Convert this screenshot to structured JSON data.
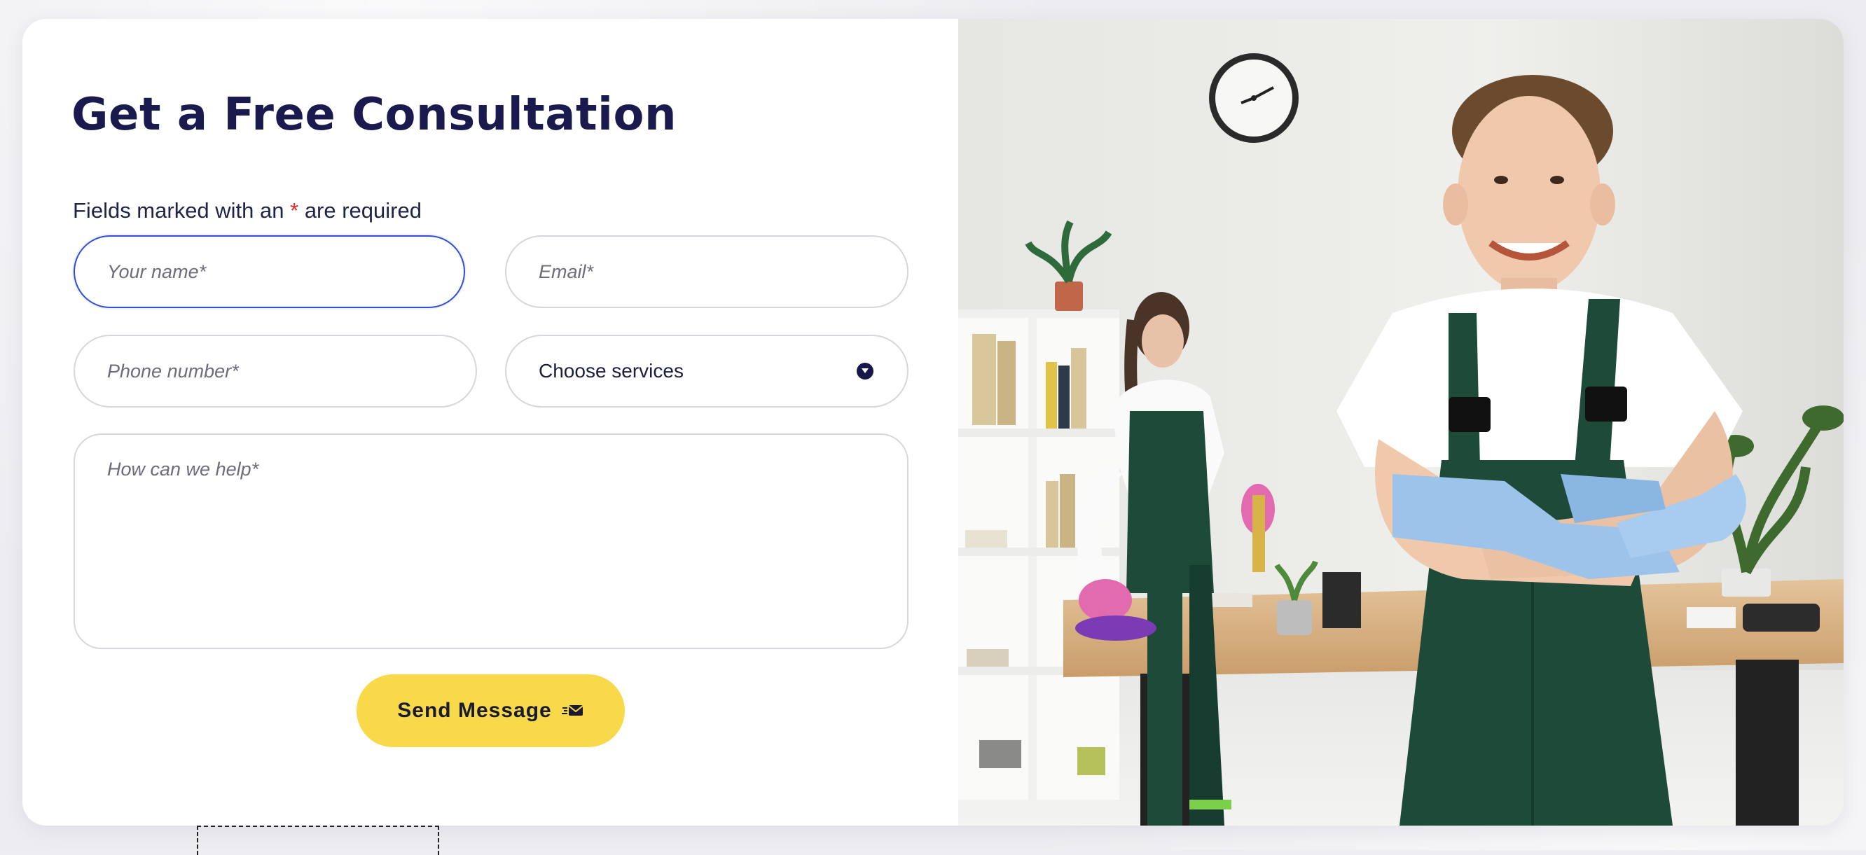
{
  "form": {
    "title": "Get a Free Consultation",
    "required_prefix": "Fields marked with an ",
    "required_star": "*",
    "required_suffix": " are required",
    "name_placeholder": "Your name*",
    "email_placeholder": "Email*",
    "phone_placeholder": "Phone number*",
    "services_value": "Choose services",
    "message_placeholder": "How can we help*",
    "send_label": "Send Message"
  },
  "icons": {
    "dropdown": "chevron-down-icon",
    "send": "envelope-send-icon"
  },
  "colors": {
    "title": "#1a1a4e",
    "accent_button": "#f8d94a",
    "required_star": "#e02424",
    "focus_border": "#2f4fd8",
    "apron_green": "#1e4a3a",
    "glove_blue": "#9cc4ea"
  },
  "photo": {
    "description_icon": "cleaning-staff-photo"
  }
}
